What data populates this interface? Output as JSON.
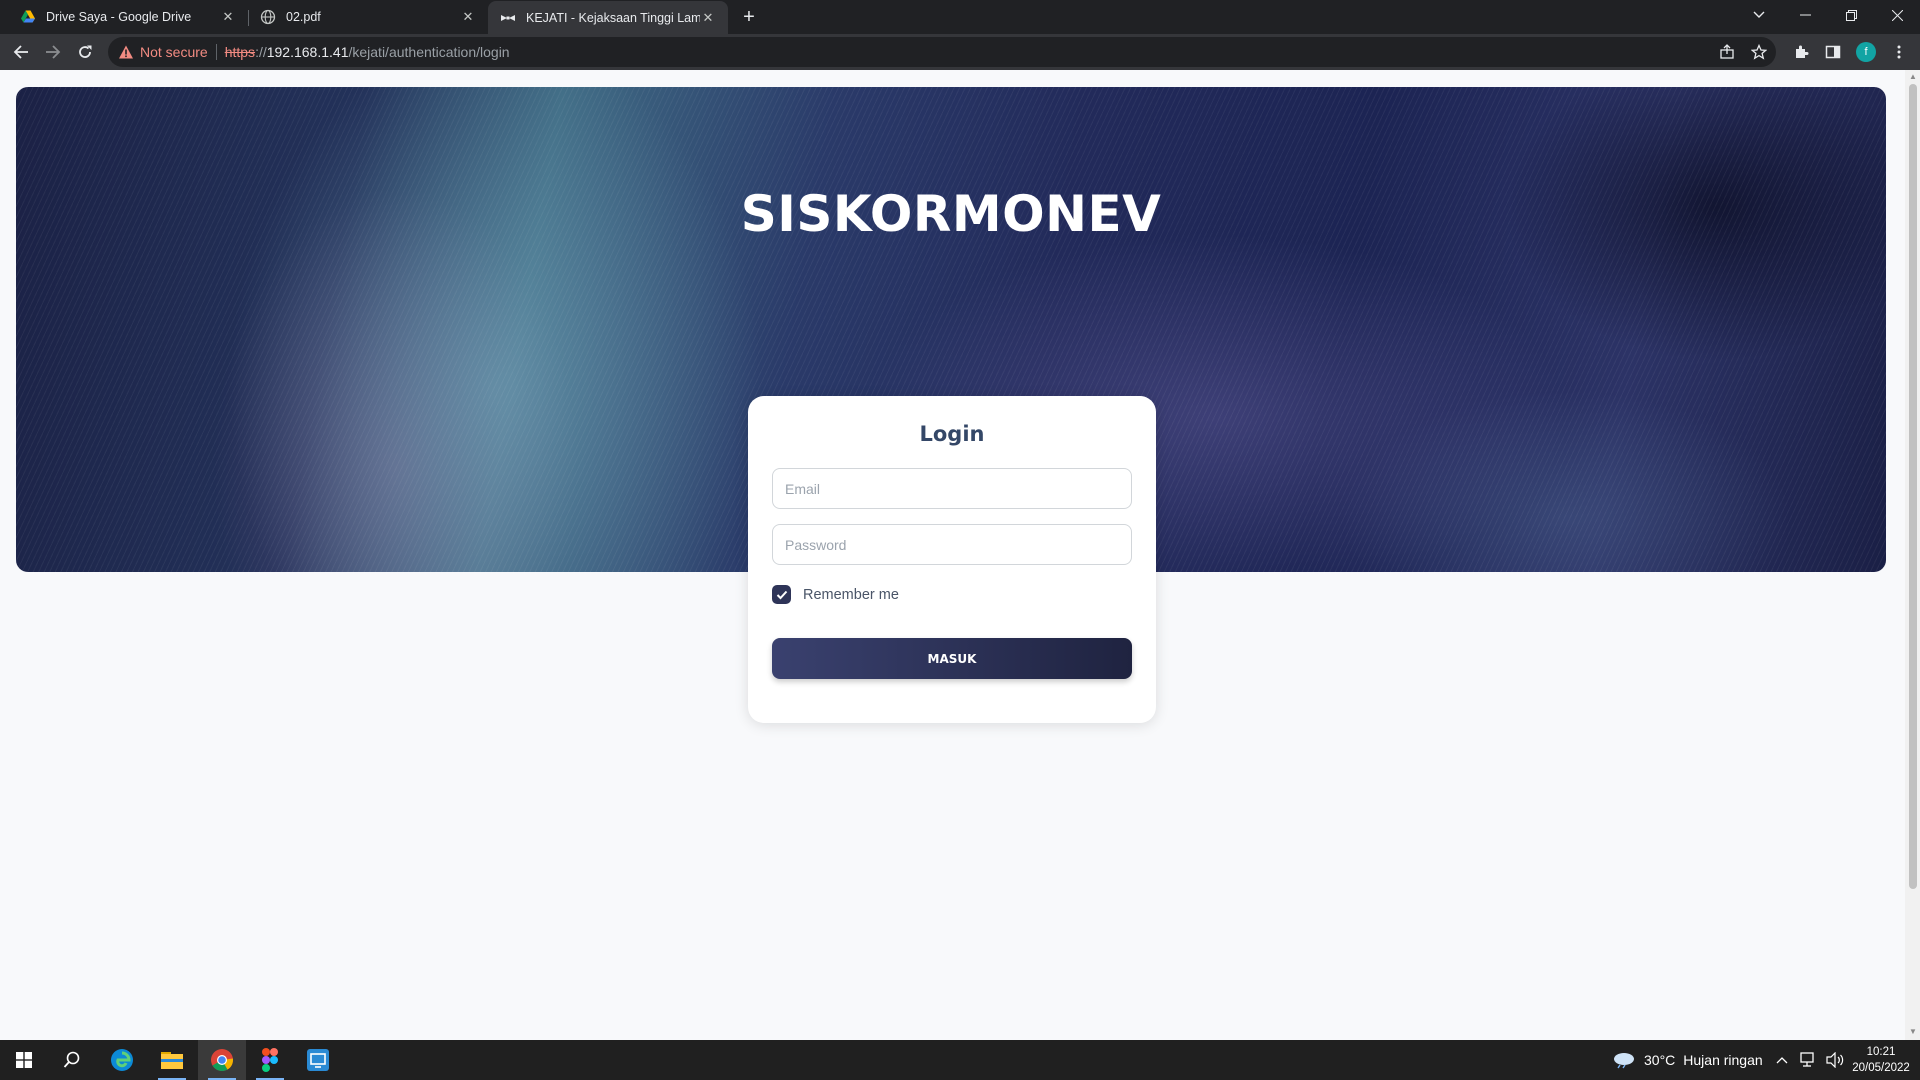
{
  "browser": {
    "tabs": [
      {
        "title": "Drive Saya - Google Drive",
        "icon": "google-drive-icon"
      },
      {
        "title": "02.pdf",
        "icon": "globe-icon"
      },
      {
        "title": "KEJATI - Kejaksaan Tinggi Lampung",
        "icon": "kejati-logo-icon",
        "active": true
      }
    ],
    "security_label": "Not secure",
    "url": {
      "scheme": "https",
      "separator": "://",
      "host": "192.168.1.41",
      "path": "/kejati/authentication/login"
    },
    "profile_initial": "f"
  },
  "hero": {
    "title": "SISKORMONEV"
  },
  "login": {
    "title": "Login",
    "email_placeholder": "Email",
    "password_placeholder": "Password",
    "remember_label": "Remember me",
    "remember_checked": true,
    "submit_label": "MASUK"
  },
  "taskbar": {
    "weather": {
      "temp": "30°C",
      "desc": "Hujan ringan"
    },
    "time": "10:21",
    "date": "20/05/2022"
  },
  "colors": {
    "accent": "#3a416f",
    "title_text": "#344767",
    "warning": "#f28b82"
  }
}
